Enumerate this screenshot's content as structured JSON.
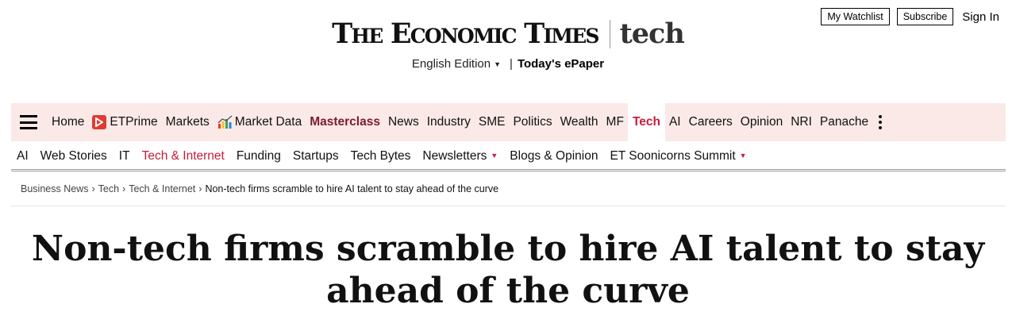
{
  "header": {
    "watchlist_label": "My Watchlist",
    "subscribe_label": "Subscribe",
    "signin_label": "Sign In",
    "logo_main": "The Economic Times",
    "logo_section": "tech",
    "edition_label": "English Edition",
    "epaper_label": "Today's ePaper"
  },
  "main_nav": {
    "items": [
      {
        "label": "Home"
      },
      {
        "label": "ETPrime",
        "icon": "play-icon"
      },
      {
        "label": "Markets"
      },
      {
        "label": "Market Data",
        "icon": "chart-icon"
      },
      {
        "label": "Masterclass"
      },
      {
        "label": "News"
      },
      {
        "label": "Industry"
      },
      {
        "label": "SME"
      },
      {
        "label": "Politics"
      },
      {
        "label": "Wealth"
      },
      {
        "label": "MF"
      },
      {
        "label": "Tech"
      },
      {
        "label": "AI"
      },
      {
        "label": "Careers"
      },
      {
        "label": "Opinion"
      },
      {
        "label": "NRI"
      },
      {
        "label": "Panache"
      }
    ],
    "active": "Tech",
    "accent_color": "#c41e3a",
    "background_color": "#fbe9e7"
  },
  "sub_nav": {
    "items": [
      {
        "label": "AI"
      },
      {
        "label": "Web Stories"
      },
      {
        "label": "IT"
      },
      {
        "label": "Tech & Internet"
      },
      {
        "label": "Funding"
      },
      {
        "label": "Startups"
      },
      {
        "label": "Tech Bytes"
      },
      {
        "label": "Newsletters"
      },
      {
        "label": "Blogs & Opinion"
      },
      {
        "label": "ET Soonicorns Summit"
      }
    ],
    "active": "Tech & Internet"
  },
  "breadcrumb": {
    "items": [
      "Business News",
      "Tech",
      "Tech & Internet"
    ],
    "current": "Non-tech firms scramble to hire AI talent to stay ahead of the curve"
  },
  "article": {
    "headline_line1": "Non-tech firms scramble to hire AI talent to stay",
    "headline_line2": "ahead of the curve"
  }
}
